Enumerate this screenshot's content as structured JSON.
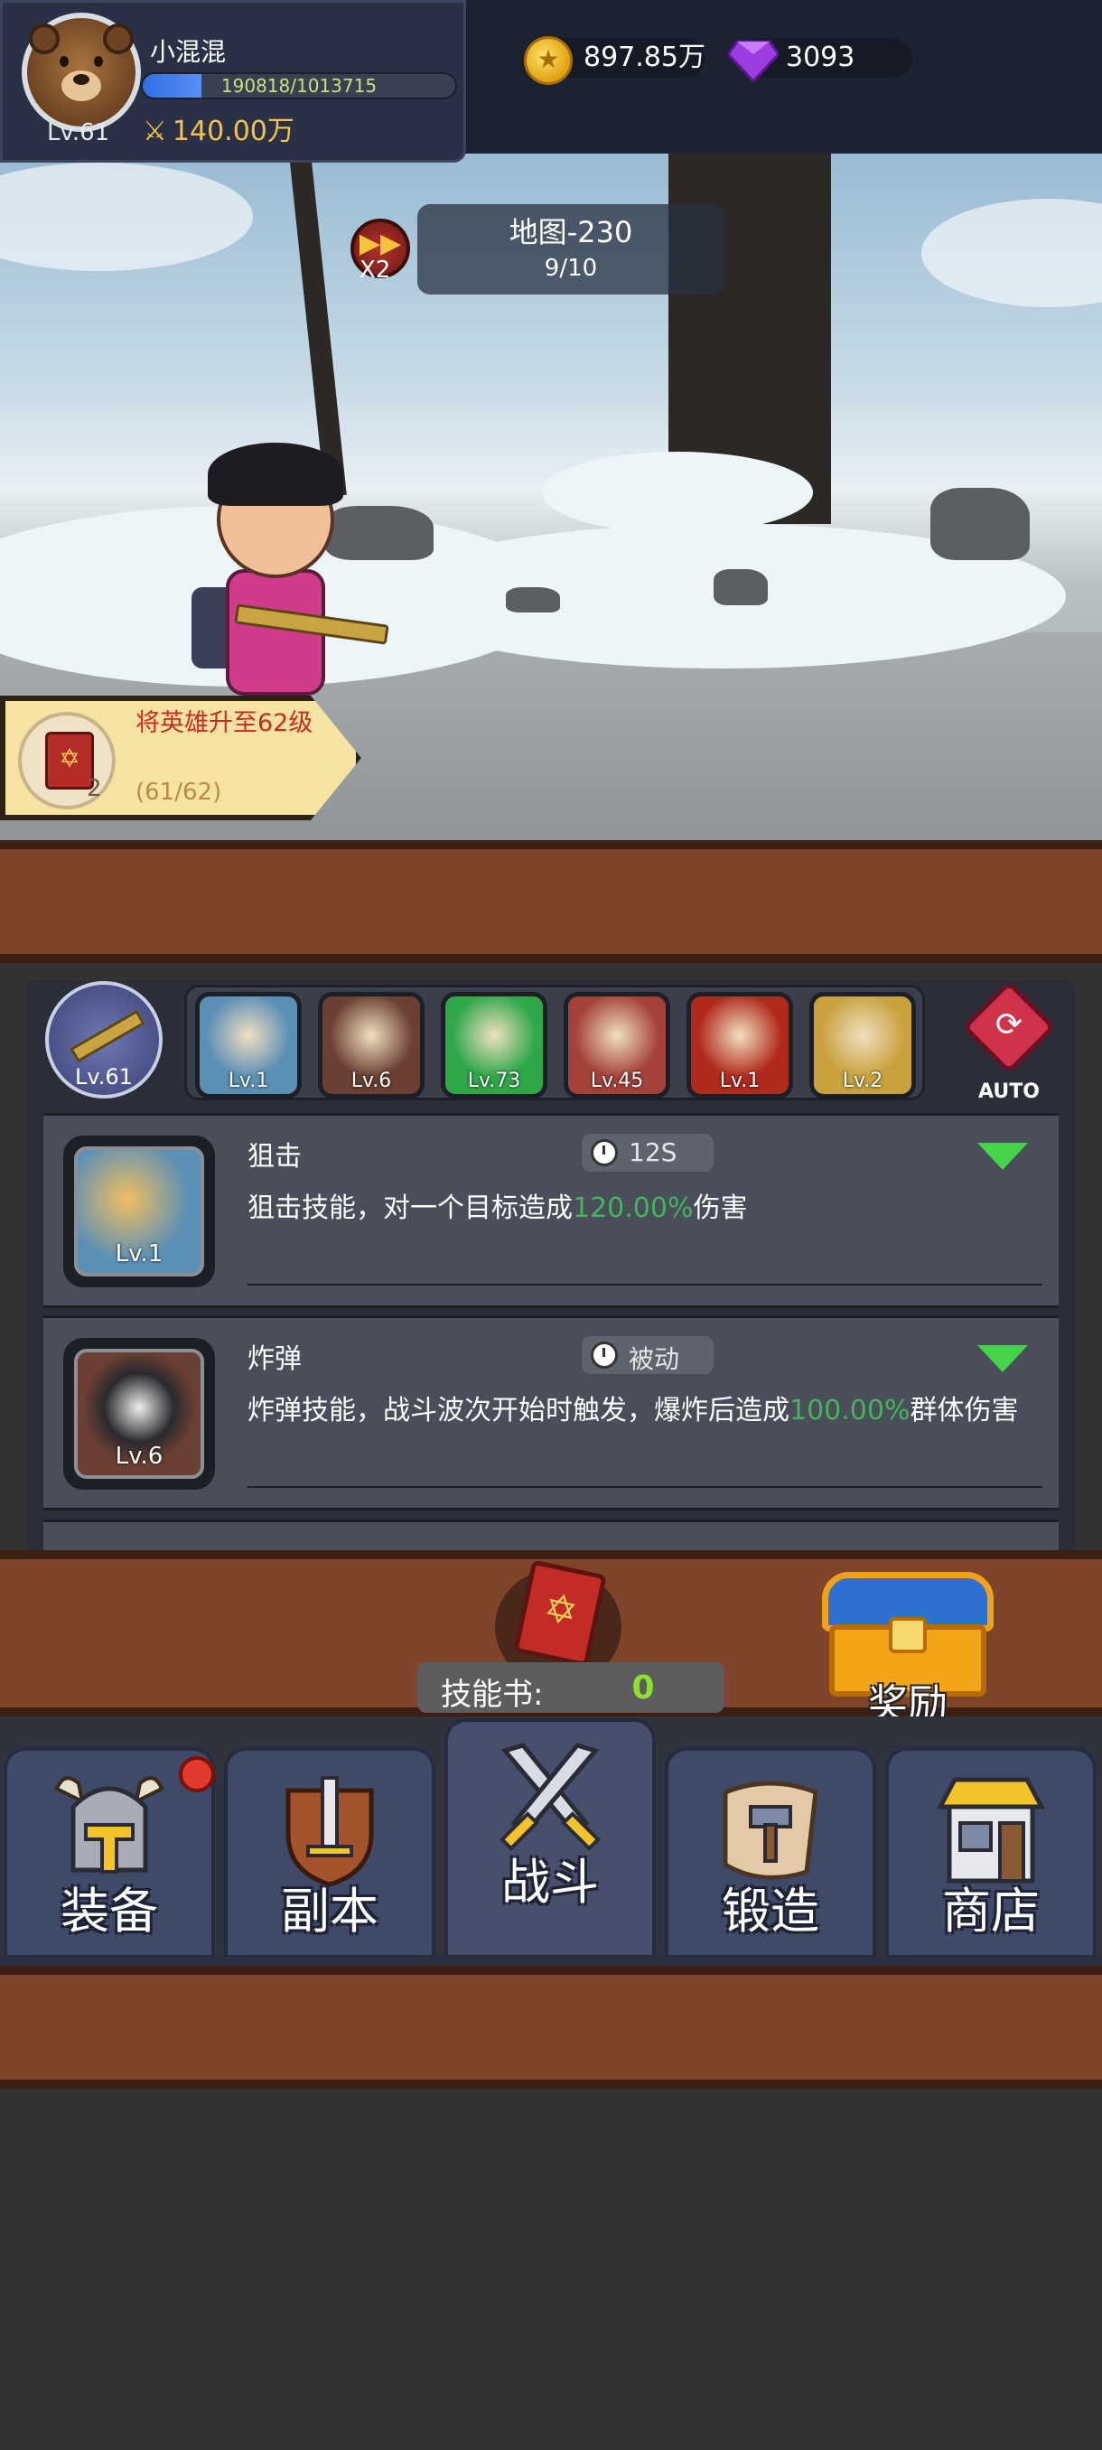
{
  "player": {
    "name": "小混混",
    "level": "Lv.61",
    "xp_text": "190818/1013715",
    "xp_fraction": 0.188,
    "power": "140.00万"
  },
  "currency": {
    "gold": "897.85万",
    "gems": "3093"
  },
  "map": {
    "title": "地图-230",
    "wave": "9/10",
    "speed": "X2"
  },
  "quest": {
    "text": "将英雄升至62级",
    "progress": "(61/62)",
    "reward_count": "2"
  },
  "weapon": {
    "level": "Lv.61"
  },
  "skill_slots": [
    {
      "name": "sniper-skill",
      "level": "Lv.1",
      "color": "#5b8fb5"
    },
    {
      "name": "bomb-skill",
      "level": "Lv.6",
      "color": "#6b3f33"
    },
    {
      "name": "poison-skill",
      "level": "Lv.73",
      "color": "#2fa84a"
    },
    {
      "name": "fire-pet-skill",
      "level": "Lv.45",
      "color": "#a4423a"
    },
    {
      "name": "fireball-skill",
      "level": "Lv.1",
      "color": "#b02a1c"
    },
    {
      "name": "lightning-skill",
      "level": "Lv.2",
      "color": "#c9a23e"
    }
  ],
  "auto_label": "AUTO",
  "skills": [
    {
      "name": "狙击",
      "level": "Lv.1",
      "cooldown": "12S",
      "desc_before": "狙击技能，对一个目标造成",
      "desc_value": "120.00%",
      "desc_after": "伤害"
    },
    {
      "name": "炸弹",
      "level": "Lv.6",
      "cooldown": "被动",
      "desc_before": "炸弹技能，战斗波次开始时触发，爆炸后造成",
      "desc_value": "100.00%",
      "desc_after": "群体伤害"
    }
  ],
  "skill_book": {
    "label": "技能书:",
    "count": "0"
  },
  "reward_label": "奖励",
  "nav": [
    {
      "label": "装备"
    },
    {
      "label": "副本"
    },
    {
      "label": "战斗"
    },
    {
      "label": "锻造"
    },
    {
      "label": "商店"
    }
  ],
  "colors": {
    "accent_green": "#46b45a",
    "gold_text": "#f5c24a",
    "quest_red": "#c62c24",
    "wood": "#7e452a"
  }
}
